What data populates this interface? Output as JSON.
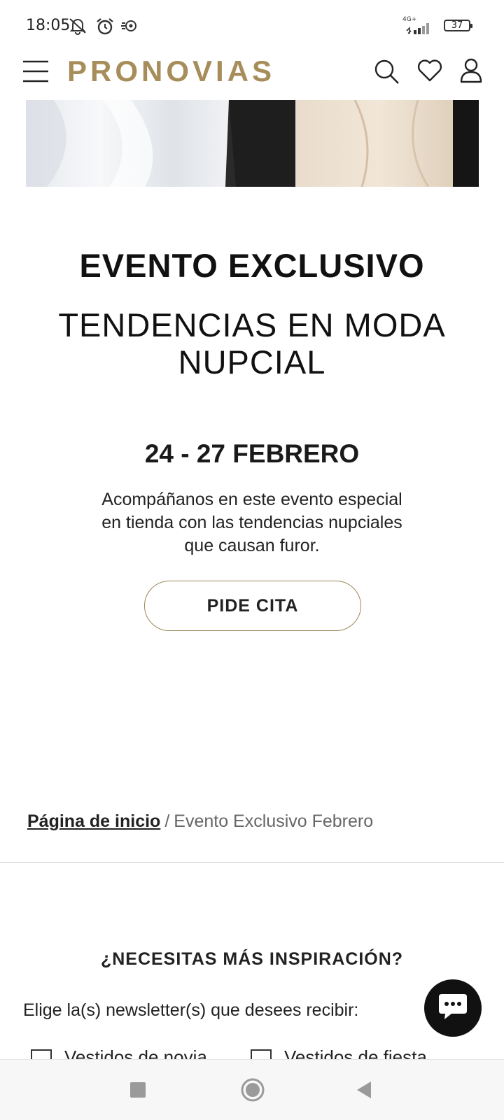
{
  "status_bar": {
    "time": "18:05",
    "network": "4G+",
    "battery": "37"
  },
  "header": {
    "logo": "PRONOVIAS",
    "icons": [
      "menu-icon",
      "search-icon",
      "heart-icon",
      "user-icon"
    ]
  },
  "event": {
    "title": "EVENTO EXCLUSIVO",
    "subtitle_line1": "TENDENCIAS EN MODA",
    "subtitle_line2": "NUPCIAL",
    "date": "24 - 27 FEBRERO",
    "desc_line1": "Acompáñanos en este evento especial",
    "desc_line2": "en tienda con las tendencias nupciales",
    "desc_line3": "que causan furor.",
    "cta": "PIDE CITA"
  },
  "breadcrumb": {
    "home": "Página de inicio",
    "separator": "/",
    "current": "Evento Exclusivo Febrero"
  },
  "newsletter": {
    "heading": "¿NECESITAS MÁS INSPIRACIÓN?",
    "prompt": "Elige la(s) newsletter(s) que desees recibir:",
    "options": [
      "Vestidos de novia",
      "Vestidos de fiesta"
    ]
  },
  "colors": {
    "brand_gold": "#a78d5a",
    "button_border": "#9c875a",
    "chat_bubble": "#111111"
  }
}
